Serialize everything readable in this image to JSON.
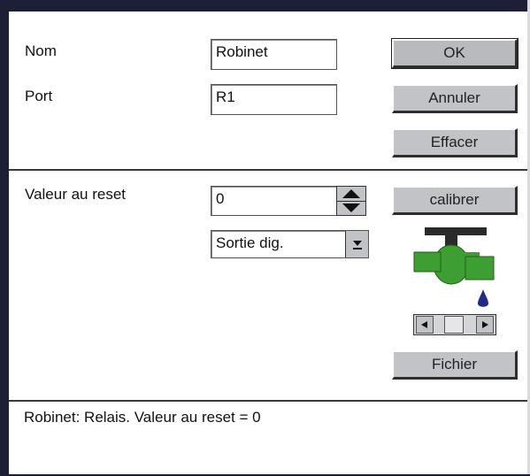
{
  "form": {
    "name_label": "Nom",
    "name_value": "Robinet",
    "port_label": "Port",
    "port_value": "R1",
    "reset_label": "Valeur au reset",
    "reset_value": "0",
    "output_type_selected": "Sortie dig."
  },
  "buttons": {
    "ok": "OK",
    "cancel": "Annuler",
    "clear": "Effacer",
    "calibrate": "calibrer",
    "file": "Fichier"
  },
  "icons": {
    "faucet": "faucet-icon",
    "water_drop": "water-drop-icon",
    "spin_up": "arrow-up-icon",
    "spin_down": "arrow-down-icon",
    "dropdown": "dropdown-arrow-icon",
    "scroll_left": "arrow-left-icon",
    "scroll_right": "arrow-right-icon"
  },
  "colors": {
    "faucet_green": "#3d9e31",
    "faucet_dark": "#2a2a2a",
    "drop_blue": "#1f2a8c",
    "button_face": "#c2c3c7"
  },
  "status": {
    "text": "Robinet: Relais. Valeur au reset = 0"
  }
}
